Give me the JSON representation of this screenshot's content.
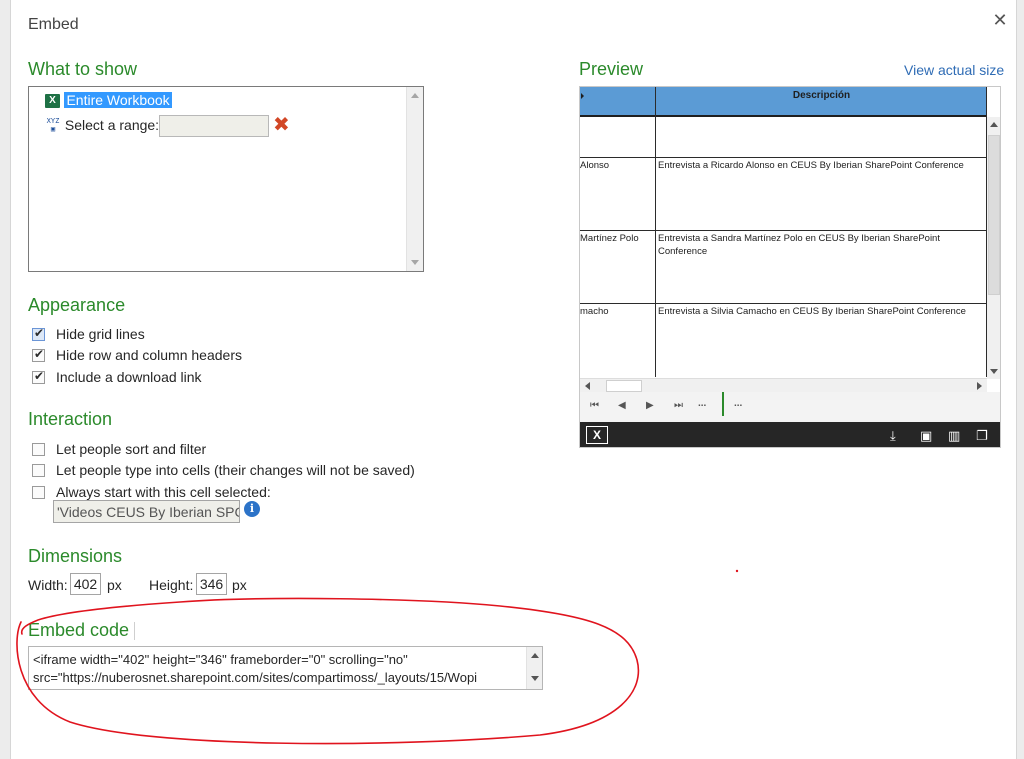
{
  "dialog": {
    "title": "Embed",
    "close_icon": "close-icon"
  },
  "what_to_show": {
    "heading": "What to show",
    "option_entire": "Entire Workbook",
    "option_range_label": "Select a range:",
    "range_value": ""
  },
  "preview": {
    "heading": "Preview",
    "view_actual_size": "View actual size",
    "column_header": "Descripción",
    "rows": [
      {
        "name": "Alonso",
        "desc": "Entrevista a Ricardo Alonso en CEUS By Iberian SharePoint Conference"
      },
      {
        "name": "Martínez Polo",
        "desc": "Entrevista a Sandra Martínez Polo en CEUS By Iberian SharePoint Conference"
      },
      {
        "name": "macho",
        "desc": "Entrevista a Silvia Camacho en CEUS By Iberian SharePoint Conference"
      }
    ],
    "sheet_dots_1": "...",
    "sheet_dots_2": "..."
  },
  "appearance": {
    "heading": "Appearance",
    "options": [
      {
        "label": "Hide grid lines",
        "checked": true
      },
      {
        "label": "Hide row and column headers",
        "checked": true
      },
      {
        "label": "Include a download link",
        "checked": true
      }
    ]
  },
  "interaction": {
    "heading": "Interaction",
    "options": [
      {
        "label": "Let people sort and filter",
        "checked": false
      },
      {
        "label": "Let people type into cells (their changes will not be saved)",
        "checked": false
      },
      {
        "label": "Always start with this cell selected:",
        "checked": false
      }
    ],
    "cell_value": "'Videos CEUS By Iberian SPC"
  },
  "dimensions": {
    "heading": "Dimensions",
    "width_label": "Width:",
    "width_value": "402",
    "width_unit": "px",
    "height_label": "Height:",
    "height_value": "346",
    "height_unit": "px"
  },
  "embed_code": {
    "heading": "Embed code",
    "line1": "<iframe width=\"402\" height=\"346\" frameborder=\"0\" scrolling=\"no\"",
    "line2": "src=\"https://nuberosnet.sharepoint.com/sites/compartimoss/_layouts/15/Wopi"
  },
  "colors": {
    "heading_green": "#2b8a2b",
    "link_blue": "#2f6cb5",
    "annotation_red": "#e0141e",
    "excel_green": "#1e7145",
    "preview_header_blue": "#5b9bd5"
  }
}
